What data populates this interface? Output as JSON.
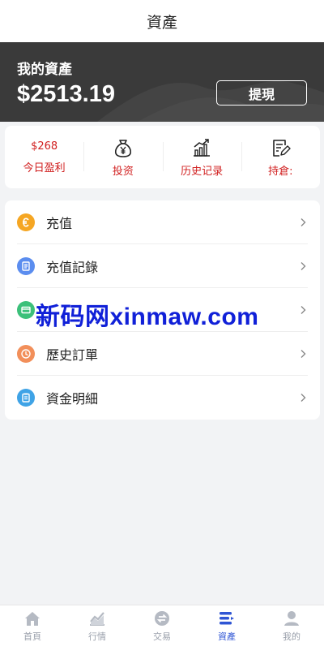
{
  "header": {
    "title": "資產"
  },
  "hero": {
    "label": "我的資產",
    "amount": "$2513.19",
    "withdraw_label": "提現"
  },
  "quick": {
    "profit_value": "$268",
    "profit_label": "今日盈利",
    "invest_label": "投资",
    "history_label": "历史记录",
    "holdings_label": "持倉:"
  },
  "menu": [
    {
      "label": "充值",
      "icon": "recharge-icon",
      "color": "#f5a623"
    },
    {
      "label": "充值記錄",
      "icon": "recharge-record-icon",
      "color": "#5b8def"
    },
    {
      "label": "",
      "icon": "card-icon",
      "color": "#3cc07a"
    },
    {
      "label": "歷史訂單",
      "icon": "clock-icon",
      "color": "#f28f5a"
    },
    {
      "label": "資金明細",
      "icon": "fund-detail-icon",
      "color": "#3fa3e6"
    }
  ],
  "watermark": "新码网xinmaw.com",
  "tabbar": [
    {
      "label": "首頁",
      "icon": "home-icon"
    },
    {
      "label": "行情",
      "icon": "market-icon"
    },
    {
      "label": "交易",
      "icon": "trade-icon"
    },
    {
      "label": "資產",
      "icon": "assets-icon"
    },
    {
      "label": "我的",
      "icon": "user-icon"
    }
  ],
  "colors": {
    "accent": "#2f55d4",
    "profit": "#d12020",
    "hero_bg": "#3a3a3a"
  }
}
